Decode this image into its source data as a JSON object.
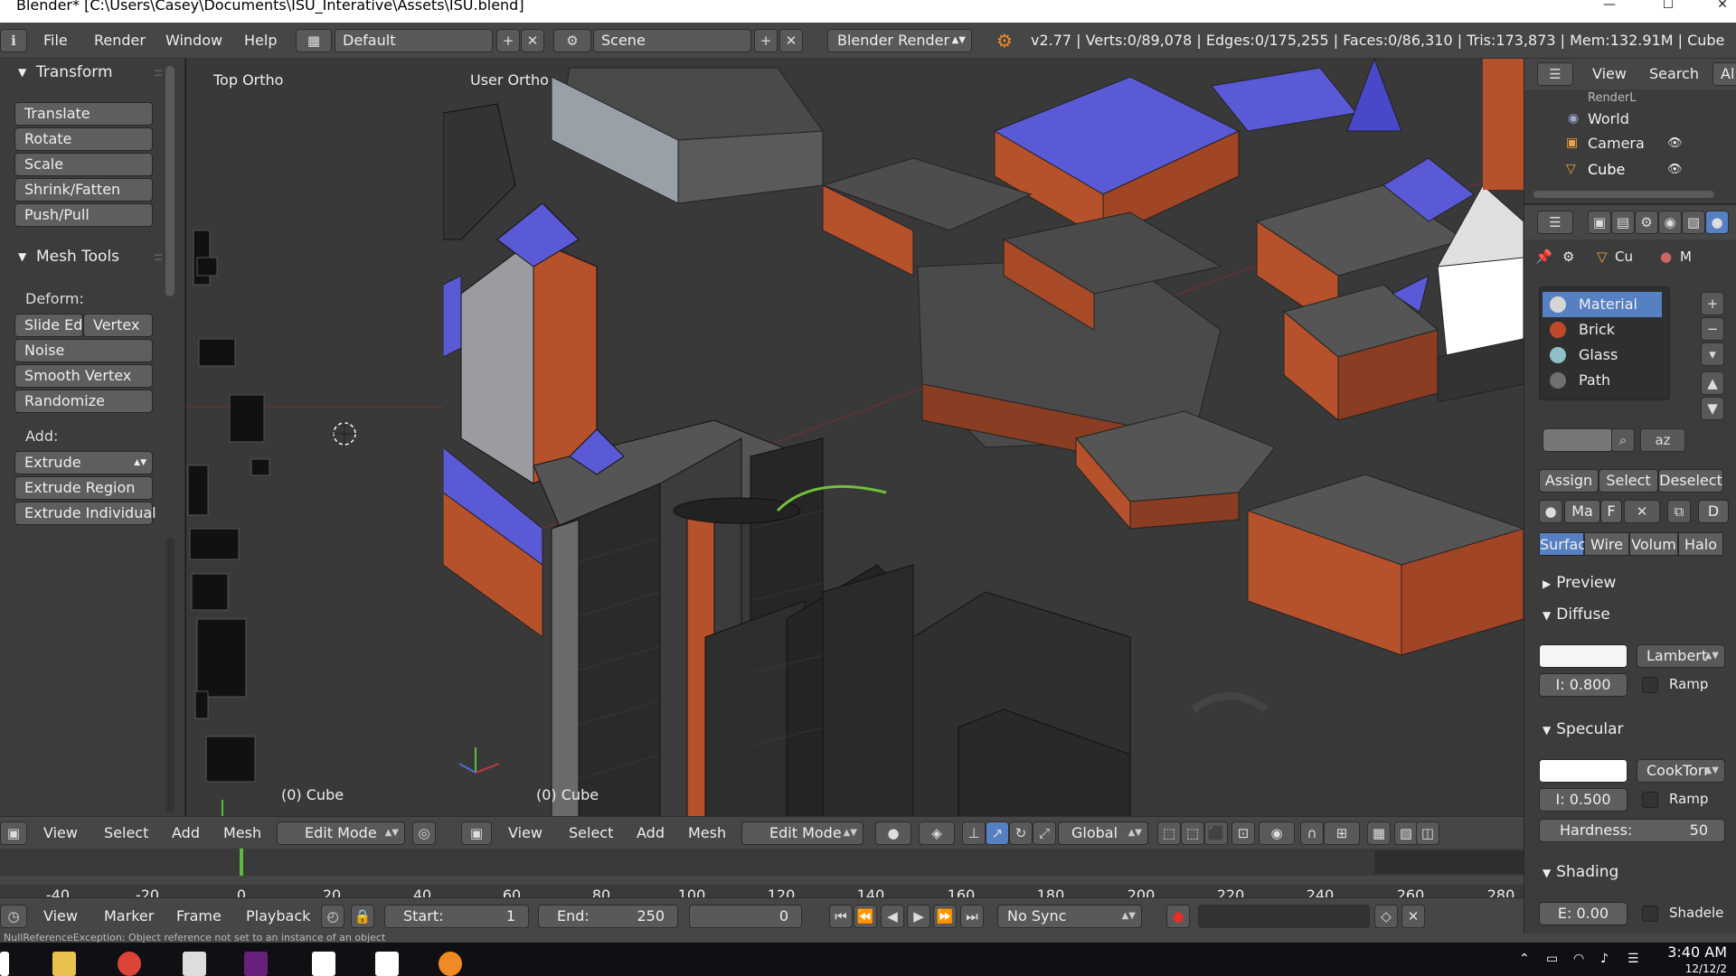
{
  "window": {
    "title": "Blender* [C:\\Users\\Casey\\Documents\\ISU_Interative\\Assets\\ISU.blend]"
  },
  "info_header": {
    "menus": [
      "File",
      "Render",
      "Window",
      "Help"
    ],
    "screen_layout": "Default",
    "scene": "Scene",
    "render_engine": "Blender Render",
    "stats": "v2.77 | Verts:0/89,078 | Edges:0/175,255 | Faces:0/86,310 | Tris:173,873 | Mem:132.91M | Cube"
  },
  "tool_panel": {
    "transform_title": "Transform",
    "transform_buttons": [
      "Translate",
      "Rotate",
      "Scale",
      "Shrink/Fatten",
      "Push/Pull"
    ],
    "mesh_tools_title": "Mesh Tools",
    "deform_label": "Deform:",
    "slide_edge": "Slide Ed",
    "vertex": "Vertex",
    "deform_buttons": [
      "Noise",
      "Smooth Vertex",
      "Randomize"
    ],
    "add_label": "Add:",
    "extrude": "Extrude",
    "add_buttons": [
      "Extrude Region",
      "Extrude Individual"
    ]
  },
  "viewport_top": {
    "label": "Top Ortho",
    "object_label": "(0) Cube"
  },
  "viewport_user": {
    "label": "User Ortho",
    "object_label": "(0) Cube"
  },
  "view_header_left": {
    "menus": [
      "View",
      "Select",
      "Add",
      "Mesh"
    ],
    "mode": "Edit Mode"
  },
  "view_header_main": {
    "menus": [
      "View",
      "Select",
      "Add",
      "Mesh"
    ],
    "mode": "Edit Mode",
    "orientation": "Global"
  },
  "timeline": {
    "ticks": [
      "-40",
      "-20",
      "0",
      "20",
      "40",
      "60",
      "80",
      "100",
      "120",
      "140",
      "160",
      "180",
      "200",
      "220",
      "240",
      "260",
      "280"
    ],
    "menus": [
      "View",
      "Marker",
      "Frame",
      "Playback"
    ],
    "start_label": "Start:",
    "start_value": "1",
    "end_label": "End:",
    "end_value": "250",
    "current_frame": "0",
    "sync": "No Sync"
  },
  "outliner": {
    "menus": [
      "View",
      "Search",
      "Al"
    ],
    "items": [
      "RenderL",
      "World",
      "Camera",
      "Cube"
    ]
  },
  "properties": {
    "context_object": "Cu",
    "context_material": "M",
    "materials": [
      {
        "name": "Material",
        "color": "#c8c8c8"
      },
      {
        "name": "Brick",
        "color": "#c0492a"
      },
      {
        "name": "Glass",
        "color": "#8fc0c8"
      },
      {
        "name": "Path",
        "color": "#707070"
      }
    ],
    "assign": "Assign",
    "select": "Select",
    "deselect": "Deselect",
    "material_short": "Ma",
    "f_label": "F",
    "d_label": "D",
    "tabs": [
      "Surfac",
      "Wire",
      "Volum",
      "Halo"
    ],
    "preview_title": "Preview",
    "diffuse_title": "Diffuse",
    "diffuse_shader": "Lambert",
    "diffuse_intensity": "I: 0.800",
    "ramp": "Ramp",
    "specular_title": "Specular",
    "specular_shader": "CookTorr",
    "specular_intensity": "I: 0.500",
    "hardness_label": "Hardness:",
    "hardness_value": "50",
    "shading_title": "Shading",
    "emit": "E: 0.00",
    "shadeless": "Shadele"
  },
  "status_bar": {
    "message": "NullReferenceException: Object reference not set to an instance of an object"
  },
  "clock": {
    "time": "3:40 AM",
    "date": "12/12/2"
  },
  "colors": {
    "accent_blue": "#5680c2",
    "brick": "#b5512b",
    "roof_blue": "#5a5ad6",
    "grey_bg": "#393939"
  }
}
